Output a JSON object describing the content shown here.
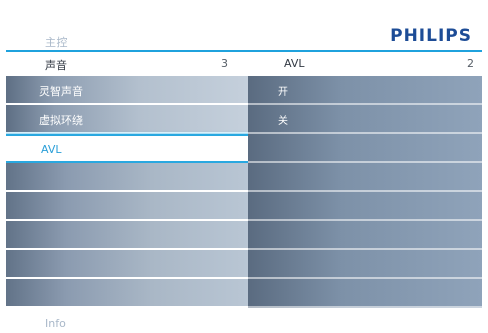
{
  "header": {
    "menu_title": "主控",
    "brand": "PHILIPS"
  },
  "breadcrumb": {
    "left_label": "声音",
    "left_value": "3",
    "right_label": "AVL",
    "right_value": "2"
  },
  "left_menu": {
    "items": [
      {
        "label": "灵智声音"
      },
      {
        "label": "虚拟环绕"
      },
      {
        "label": "AVL",
        "selected": true
      },
      {
        "label": ""
      },
      {
        "label": ""
      },
      {
        "label": ""
      },
      {
        "label": ""
      },
      {
        "label": ""
      }
    ]
  },
  "right_menu": {
    "items": [
      {
        "label": "开"
      },
      {
        "label": "关"
      },
      {
        "label": ""
      },
      {
        "label": ""
      },
      {
        "label": ""
      },
      {
        "label": ""
      },
      {
        "label": ""
      },
      {
        "label": ""
      }
    ]
  },
  "footer": {
    "info": "Info"
  },
  "colors": {
    "accent": "#1fa2dd",
    "brand": "#1d4c96"
  }
}
